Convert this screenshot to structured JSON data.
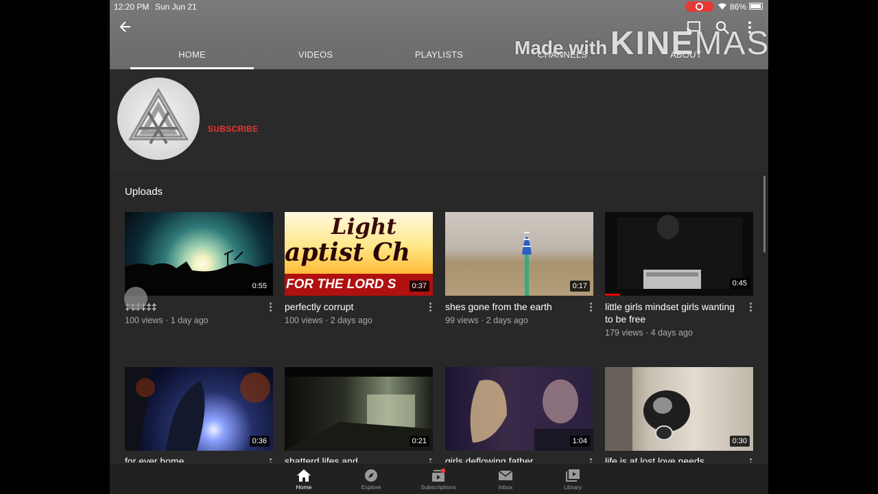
{
  "status_bar": {
    "time": "12:20 PM",
    "date": "Sun Jun 21",
    "battery": "86%",
    "rec_color": "#e53935"
  },
  "tabs": [
    {
      "label": "HOME",
      "active": true
    },
    {
      "label": "VIDEOS"
    },
    {
      "label": "PLAYLISTS"
    },
    {
      "label": "CHANNELS"
    },
    {
      "label": "ABOUT"
    }
  ],
  "watermark": {
    "prefix": "Made with",
    "brand_a": "KINE",
    "brand_b": "MASTER"
  },
  "channel": {
    "subscribe_label": "SUBSCRIBE",
    "subscribe_color": "#e53935",
    "avatar_icon": "triangle-knot-logo"
  },
  "uploads": {
    "title": "Uploads",
    "videos": [
      {
        "title": "‡‡‡‡‡‡",
        "views": "100 views",
        "age": "1 day ago",
        "duration": "0:55"
      },
      {
        "title": "perfectly corrupt",
        "views": "100 views",
        "age": "2 days ago",
        "duration": "0:37"
      },
      {
        "title": "shes gone from the earth",
        "views": "99 views",
        "age": "2 days ago",
        "duration": "0:17"
      },
      {
        "title": "little girls mindset girls wanting to be free",
        "views": "179 views",
        "age": "4 days ago",
        "duration": "0:45",
        "watched_fraction": 0.1
      },
      {
        "title": "for ever home",
        "duration": "0:36"
      },
      {
        "title": "shatterd lifes and",
        "duration": "0:21"
      },
      {
        "title": "girls deflowing father",
        "duration": "1:04"
      },
      {
        "title": "life is at lost love needs",
        "duration": "0:30"
      }
    ]
  },
  "thumb2_text": {
    "line1": "Light",
    "line2": "aptist Ch",
    "line3": "FOR THE LORD S"
  },
  "bottom_nav": [
    {
      "label": "Home",
      "icon": "home-icon",
      "active": true
    },
    {
      "label": "Explore",
      "icon": "compass-icon"
    },
    {
      "label": "Subscriptions",
      "icon": "subscriptions-icon"
    },
    {
      "label": "Inbox",
      "icon": "mail-icon"
    },
    {
      "label": "Library",
      "icon": "library-icon"
    }
  ]
}
